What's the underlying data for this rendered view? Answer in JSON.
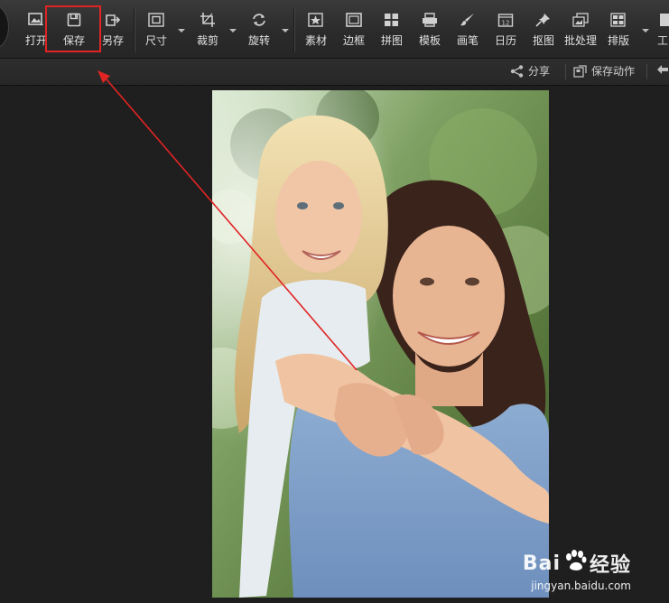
{
  "toolbar": {
    "items": [
      {
        "label": "打开",
        "icon": "open-image-icon"
      },
      {
        "label": "保存",
        "icon": "save-icon"
      },
      {
        "label": "另存",
        "icon": "save-as-icon"
      },
      {
        "label": "尺寸",
        "icon": "resize-icon"
      },
      {
        "label": "裁剪",
        "icon": "crop-icon"
      },
      {
        "label": "旋转",
        "icon": "rotate-icon"
      },
      {
        "label": "素材",
        "icon": "sticker-icon"
      },
      {
        "label": "边框",
        "icon": "frame-icon"
      },
      {
        "label": "拼图",
        "icon": "collage-icon"
      },
      {
        "label": "模板",
        "icon": "template-icon"
      },
      {
        "label": "画笔",
        "icon": "brush-icon"
      },
      {
        "label": "日历",
        "icon": "calendar-icon",
        "icon_text": "12"
      },
      {
        "label": "抠图",
        "icon": "cutout-pin-icon"
      },
      {
        "label": "批处理",
        "icon": "batch-icon"
      },
      {
        "label": "排版",
        "icon": "layout-icon"
      },
      {
        "label": "工",
        "icon": "tools-icon"
      }
    ]
  },
  "subbar": {
    "share": "分享",
    "save_action": "保存动作"
  },
  "annotation": {
    "color": "#e02424"
  },
  "watermark": {
    "brand_left": "Bai",
    "brand_right": "经验",
    "url": "jingyan.baidu.com"
  }
}
